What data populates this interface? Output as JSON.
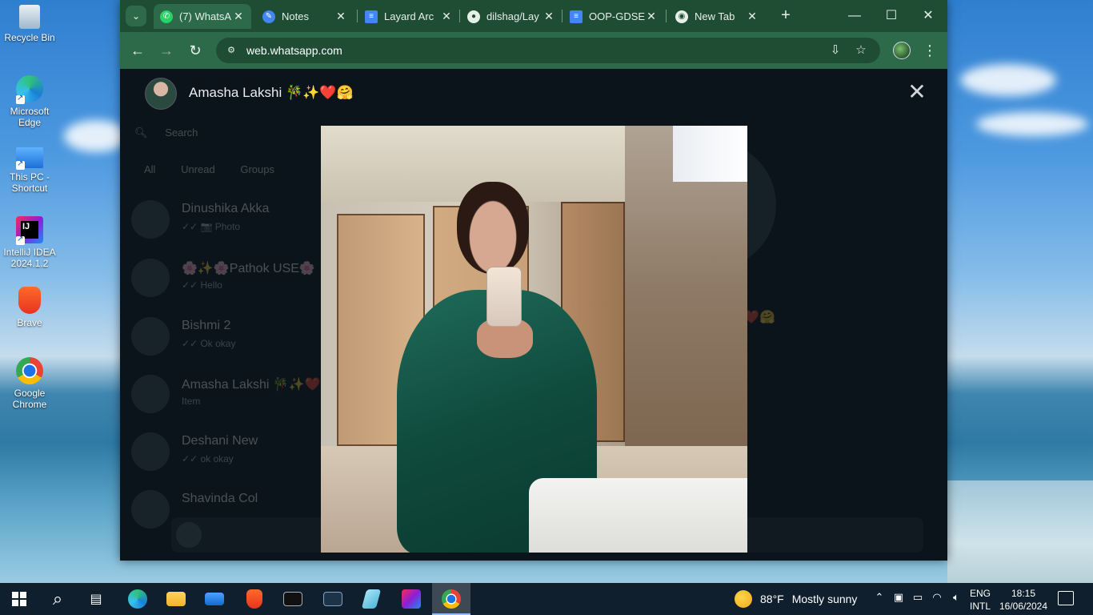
{
  "desktop": {
    "icons": [
      {
        "name": "recycle-bin",
        "label": "Recycle Bin"
      },
      {
        "name": "microsoft-edge",
        "label": "Microsoft Edge"
      },
      {
        "name": "this-pc",
        "label": "This PC - Shortcut"
      },
      {
        "name": "intellij",
        "label": "IntelliJ IDEA 2024.1.2"
      },
      {
        "name": "brave",
        "label": "Brave"
      },
      {
        "name": "google-chrome",
        "label": "Google Chrome"
      }
    ]
  },
  "browser": {
    "tabs": [
      {
        "label": "(7) WhatsA",
        "icon": "whatsapp-icon",
        "active": true
      },
      {
        "label": "Notes",
        "icon": "notes-icon",
        "active": false
      },
      {
        "label": "Layard Arc",
        "icon": "docs-icon",
        "active": false
      },
      {
        "label": "dilshag/Lay",
        "icon": "github-icon",
        "active": false
      },
      {
        "label": "OOP-GDSE",
        "icon": "docs-icon",
        "active": false
      },
      {
        "label": "New Tab",
        "icon": "chrome-icon",
        "active": false
      }
    ],
    "url": "web.whatsapp.com",
    "colors": {
      "frame": "#1f4d34",
      "toolbar": "#2d6a4a"
    }
  },
  "viewer": {
    "contact_name": "Amasha Lakshi 🎋✨❤️🤗"
  },
  "background_chat": {
    "search_placeholder": "Search",
    "filters": [
      "All",
      "Unread",
      "Groups"
    ],
    "chats": [
      {
        "name": "Dinushika Akka",
        "preview": "✓✓ 📷 Photo"
      },
      {
        "name": "🌸✨🌸Pathok USE🌸",
        "preview": "✓✓ Hello"
      },
      {
        "name": "Bishmi 2",
        "preview": "✓✓ Ok okay"
      },
      {
        "name": "Amasha Lakshi 🎋✨❤️",
        "preview": "Item"
      },
      {
        "name": "Deshani New",
        "preview": "✓✓ ok okay"
      },
      {
        "name": "Shavinda Col",
        "preview": ""
      }
    ],
    "right_text": "+❤️🤗"
  },
  "taskbar": {
    "weather_temp": "88°F",
    "weather_text": "Mostly sunny",
    "lang_1": "ENG",
    "lang_2": "INTL",
    "time": "18:15",
    "date": "16/06/2024"
  }
}
